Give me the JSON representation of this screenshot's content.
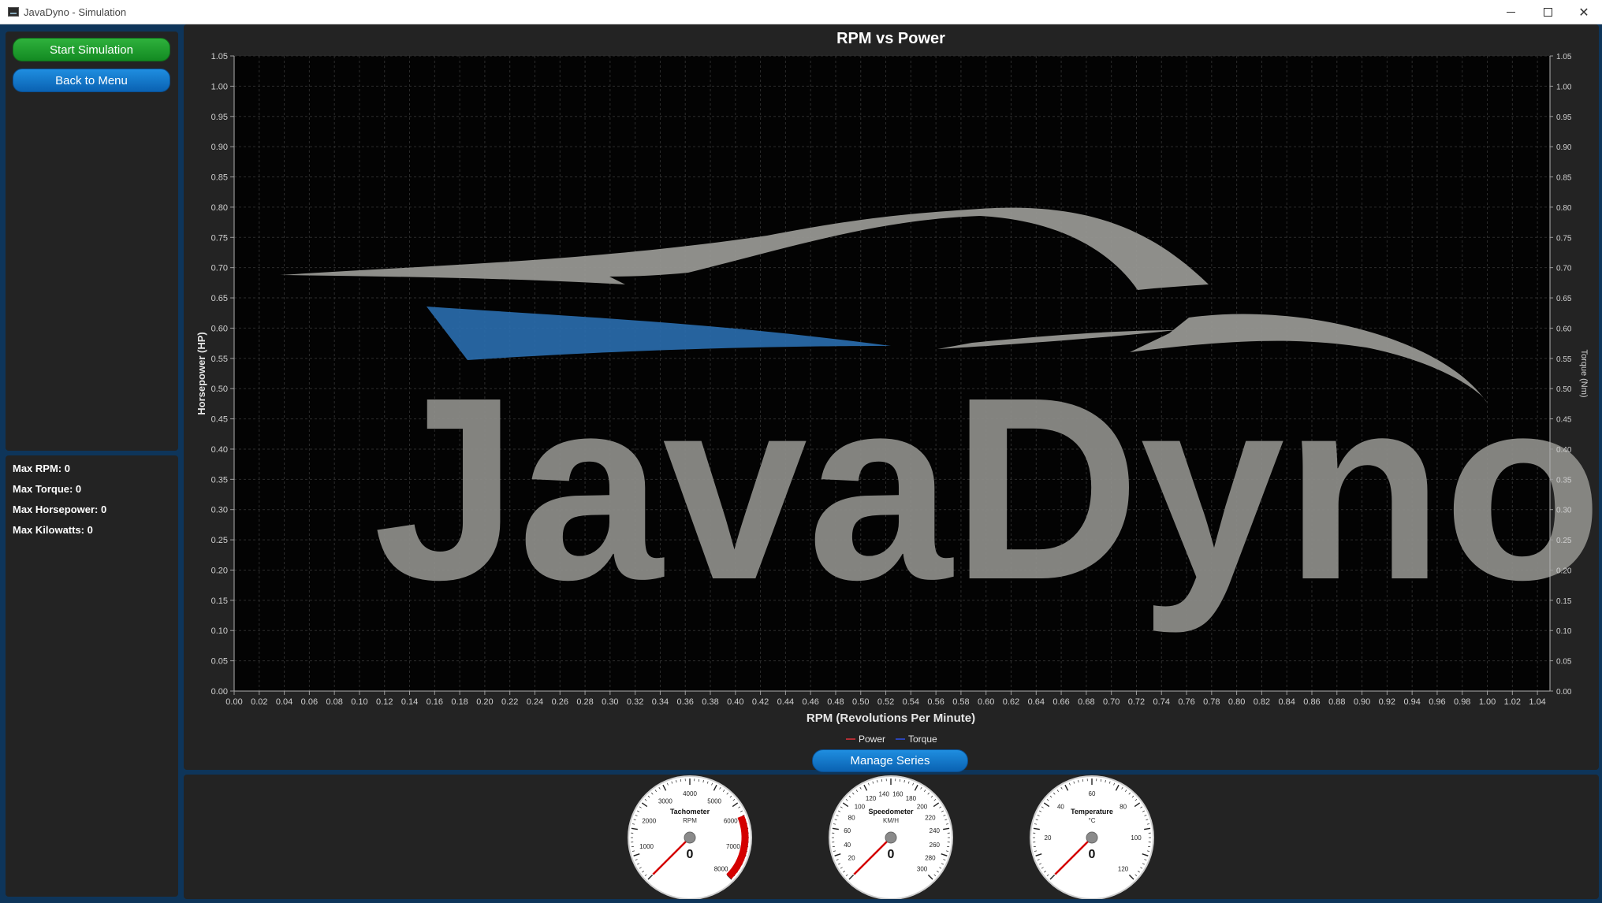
{
  "window": {
    "title": "JavaDyno - Simulation"
  },
  "sidebar": {
    "start_label": "Start Simulation",
    "back_label": "Back to Menu"
  },
  "stats": [
    {
      "label": "Max RPM: 0"
    },
    {
      "label": "Max Torque: 0"
    },
    {
      "label": "Max Horsepower: 0"
    },
    {
      "label": "Max Kilowatts: 0"
    }
  ],
  "chart": {
    "watermark": "JavaDyno",
    "manage_label": "Manage Series"
  },
  "chart_data": {
    "type": "line",
    "title": "RPM vs Power",
    "xlabel": "RPM (Revolutions Per Minute)",
    "ylabel": "Horsepower (HP)",
    "y2label": "Torque (Nm)",
    "xlim": [
      0,
      1.05
    ],
    "ylim": [
      0,
      1.05
    ],
    "y2lim": [
      0,
      1.05
    ],
    "x_ticks": [
      "0.00",
      "0.02",
      "0.04",
      "0.06",
      "0.08",
      "0.10",
      "0.12",
      "0.14",
      "0.16",
      "0.18",
      "0.20",
      "0.22",
      "0.24",
      "0.26",
      "0.28",
      "0.30",
      "0.32",
      "0.34",
      "0.36",
      "0.38",
      "0.40",
      "0.42",
      "0.44",
      "0.46",
      "0.48",
      "0.50",
      "0.52",
      "0.54",
      "0.56",
      "0.58",
      "0.60",
      "0.62",
      "0.64",
      "0.66",
      "0.68",
      "0.70",
      "0.72",
      "0.74",
      "0.76",
      "0.78",
      "0.80",
      "0.82",
      "0.84",
      "0.86",
      "0.88",
      "0.90",
      "0.92",
      "0.94",
      "0.96",
      "0.98",
      "1.00",
      "1.02",
      "1.04"
    ],
    "y_ticks": [
      "0.00",
      "0.05",
      "0.10",
      "0.15",
      "0.20",
      "0.25",
      "0.30",
      "0.35",
      "0.40",
      "0.45",
      "0.50",
      "0.55",
      "0.60",
      "0.65",
      "0.70",
      "0.75",
      "0.80",
      "0.85",
      "0.90",
      "0.95",
      "1.00",
      "1.05"
    ],
    "grid": true,
    "legend_position": "bottom",
    "series": [
      {
        "name": "Power",
        "color": "#e0323a",
        "values": []
      },
      {
        "name": "Torque",
        "color": "#2e4fe8",
        "values": []
      }
    ]
  },
  "gauges": [
    {
      "title": "Tachometer",
      "unit": "RPM",
      "value": "0",
      "ticks": [
        "1000",
        "2000",
        "3000",
        "4000",
        "5000",
        "6000",
        "7000",
        "8000"
      ]
    },
    {
      "title": "Speedometer",
      "unit": "KM/H",
      "value": "0",
      "ticks": [
        "20",
        "40",
        "60",
        "80",
        "100",
        "120",
        "140",
        "160",
        "180",
        "200",
        "220",
        "240",
        "260",
        "280",
        "300"
      ]
    },
    {
      "title": "Temperature",
      "unit": "°C",
      "value": "0",
      "ticks": [
        "20",
        "40",
        "60",
        "80",
        "100",
        "120"
      ]
    }
  ],
  "colors": {
    "accent_green": "#1f9d2d",
    "accent_blue": "#0a72c8",
    "redline": "#d40000",
    "panel": "#232323",
    "frame": "#0e355a"
  }
}
